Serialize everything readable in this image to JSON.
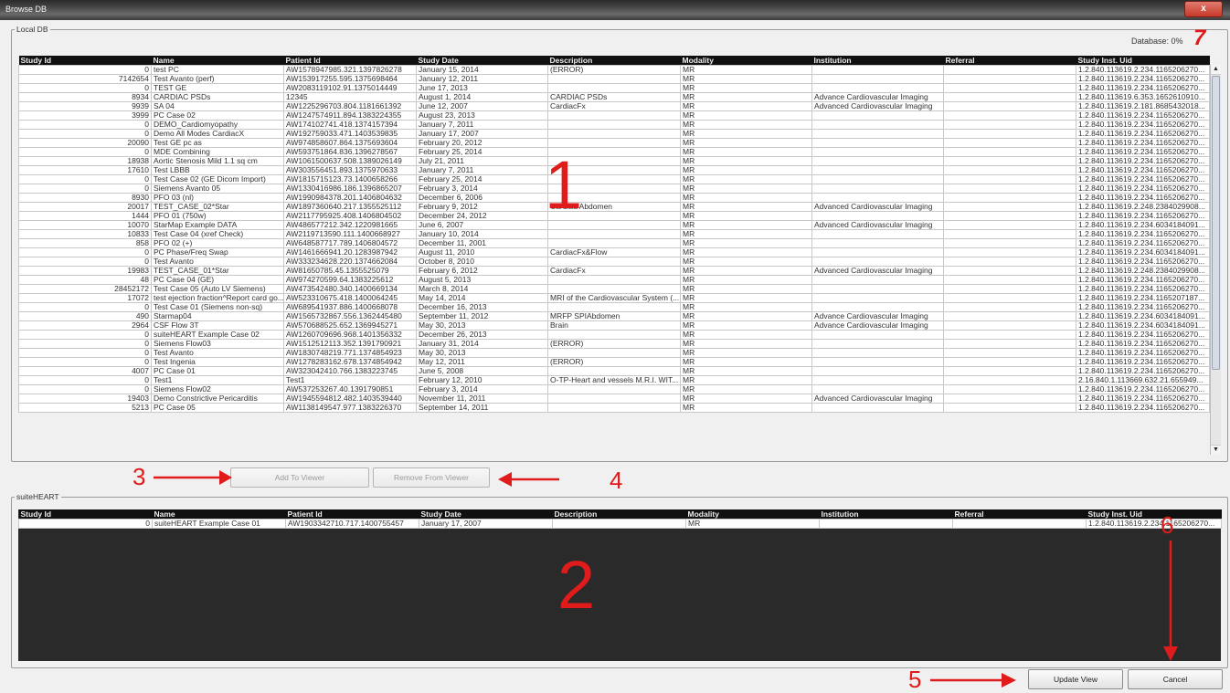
{
  "window": {
    "title": "Browse DB",
    "close_label": "x"
  },
  "local_db": {
    "label": "Local DB",
    "status": "Database:  0%",
    "columns": [
      "Study Id",
      "Name",
      "Patient Id",
      "Study Date",
      "Description",
      "Modality",
      "Institution",
      "Referral",
      "Study Inst. Uid"
    ],
    "rows": [
      [
        "0",
        "test PC",
        "AW1578947985.321.1397826278",
        "January 15, 2014",
        "(ERROR)",
        "MR",
        "",
        "",
        "1.2.840.113619.2.234.1165206270..."
      ],
      [
        "7142654",
        "Test Avanto (perf)",
        "AW153917255.595.1375698464",
        "January 12, 2011",
        "",
        "MR",
        "",
        "",
        "1.2.840.113619.2.234.1165206270..."
      ],
      [
        "0",
        "TEST GE",
        "AW2083119102.91.1375014449",
        "June 17, 2013",
        "",
        "MR",
        "",
        "",
        "1.2.840.113619.2.234.1165206270..."
      ],
      [
        "8934",
        "CARDIAC PSDs",
        "12345",
        "August 1, 2014",
        "CARDIAC PSDs",
        "MR",
        "Advance Cardiovascular Imaging",
        "",
        "1.2.840.113619.6.353.1652610910..."
      ],
      [
        "9939",
        "SA 04",
        "AW1225296703.804.1181661392",
        "June 12, 2007",
        "CardiacFx",
        "MR",
        "Advanced Cardiovascular Imaging",
        "",
        "1.2.840.113619.2.181.8685432018..."
      ],
      [
        "3999",
        "PC Case 02",
        "AW1247574911.894.1383224355",
        "August 23, 2013",
        "",
        "MR",
        "",
        "",
        "1.2.840.113619.2.234.1165206270..."
      ],
      [
        "0",
        "DEMO_Cardiomyopathy",
        "AW174102741.418.1374157394",
        "January 7, 2011",
        "",
        "MR",
        "",
        "",
        "1.2.840.113619.2.234.1165206270..."
      ],
      [
        "0",
        "Demo All Modes CardiacX",
        "AW192759033.471.1403539835",
        "January 17, 2007",
        "",
        "MR",
        "",
        "",
        "1.2.840.113619.2.234.1165206270..."
      ],
      [
        "20090",
        "Test GE pc as",
        "AW974858607.864.1375693604",
        "February 20, 2012",
        "",
        "MR",
        "",
        "",
        "1.2.840.113619.2.234.1165206270..."
      ],
      [
        "0",
        "MDE Combining",
        "AW593751864.836.1396278567",
        "February 25, 2014",
        "",
        "MR",
        "",
        "",
        "1.2.840.113619.2.234.1165206270..."
      ],
      [
        "18938",
        "Aortic Stenosis Mild 1.1 sq cm",
        "AW1061500637.508.1389026149",
        "July 21, 2011",
        "",
        "MR",
        "",
        "",
        "1.2.840.113619.2.234.1165206270..."
      ],
      [
        "17610",
        "Test LBBB",
        "AW303556451.893.1375970633",
        "January 7, 2011",
        "",
        "MR",
        "",
        "",
        "1.2.840.113619.2.234.1165206270..."
      ],
      [
        "0",
        "Test Case 02 (GE Dicom Import)",
        "AW1815715123.73.1400658266",
        "February 25, 2014",
        "",
        "MR",
        "",
        "",
        "1.2.840.113619.2.234.1165206270..."
      ],
      [
        "0",
        "Siemens Avanto 05",
        "AW1330416986.186.1396865207",
        "February 3, 2014",
        "",
        "MR",
        "",
        "",
        "1.2.840.113619.2.234.1165206270..."
      ],
      [
        "8930",
        "PFO 03 (nl)",
        "AW1990984378.201.1406804632",
        "December 6, 2006",
        "",
        "MR",
        "",
        "",
        "1.2.840.113619.2.234.1165206270..."
      ],
      [
        "20017",
        "TEST_CASE_02*Star",
        "AW1897360640.217.1355525112",
        "February 9, 2012",
        "Cardiac/Abdomen",
        "MR",
        "Advanced Cardiovascular Imaging",
        "",
        "1.2.840.113619.2.248.2384029908..."
      ],
      [
        "1444",
        "PFO 01 (750w)",
        "AW2117795925.408.1406804502",
        "December 24, 2012",
        "",
        "MR",
        "",
        "",
        "1.2.840.113619.2.234.1165206270..."
      ],
      [
        "10070",
        "StarMap Example DATA",
        "AW486577212.342.1220981665",
        "June 6, 2007",
        "",
        "MR",
        "Advanced Cardiovascular Imaging",
        "",
        "1.2.840.113619.2.234.6034184091..."
      ],
      [
        "10833",
        "Test Case 04 (xref Check)",
        "AW2119713590.111.1400668927",
        "January 10, 2014",
        "",
        "MR",
        "",
        "",
        "1.2.840.113619.2.234.1165206270..."
      ],
      [
        "858",
        "PFO 02 (+)",
        "AW648587717.789.1406804572",
        "December 11, 2001",
        "",
        "MR",
        "",
        "",
        "1.2.840.113619.2.234.1165206270..."
      ],
      [
        "0",
        "PC Phase/Freq Swap",
        "AW1461666941.20.1283987942",
        "August 11, 2010",
        "CardiacFx&Flow",
        "MR",
        "",
        "",
        "1.2.840.113619.2.234.6034184091..."
      ],
      [
        "0",
        "Test Avanto",
        "AW333234628.220.1374662084",
        "October 8, 2010",
        "",
        "MR",
        "",
        "",
        "1.2.840.113619.2.234.1165206270..."
      ],
      [
        "19983",
        "TEST_CASE_01*Star",
        "AW81650785.45.1355525079",
        "February 6, 2012",
        "CardiacFx",
        "MR",
        "Advanced Cardiovascular Imaging",
        "",
        "1.2.840.113619.2.248.2384029908..."
      ],
      [
        "48",
        "PC Case 04 (GE)",
        "AW974270599.64.1383225612",
        "August 5, 2013",
        "",
        "MR",
        "",
        "",
        "1.2.840.113619.2.234.1165206270..."
      ],
      [
        "28452172",
        "Test Case 05 (Auto LV Siemens)",
        "AW473542480.340.1400669134",
        "March 8, 2014",
        "",
        "MR",
        "",
        "",
        "1.2.840.113619.2.234.1165206270..."
      ],
      [
        "17072",
        "test ejection fraction^Report card go...",
        "AW523310675.418.1400064245",
        "May 14, 2014",
        "MRI of the Cardiovascular System (...",
        "MR",
        "",
        "",
        "1.2.840.113619.2.234.1165207187..."
      ],
      [
        "0",
        "Test Case 01 (Siemens non-sq)",
        "AW689541937.886.1400668078",
        "December 16, 2013",
        "",
        "MR",
        "",
        "",
        "1.2.840.113619.2.234.1165206270..."
      ],
      [
        "490",
        "Starmap04",
        "AW1565732867.556.1362445480",
        "September 11, 2012",
        "MRFP SPIAbdomen",
        "MR",
        "Advance Cardiovascular Imaging",
        "",
        "1.2.840.113619.2.234.6034184091..."
      ],
      [
        "2964",
        "CSF Flow 3T",
        "AW570688525.652.1369945271",
        "May 30, 2013",
        "Brain",
        "MR",
        "Advance Cardiovascular Imaging",
        "",
        "1.2.840.113619.2.234.6034184091..."
      ],
      [
        "0",
        "suiteHEART Example Case 02",
        "AW1260709696.968.1401356332",
        "December 26, 2013",
        "",
        "MR",
        "",
        "",
        "1.2.840.113619.2.234.1165206270..."
      ],
      [
        "0",
        "Siemens Flow03",
        "AW1512512113.352.1391790921",
        "January 31, 2014",
        "(ERROR)",
        "MR",
        "",
        "",
        "1.2.840.113619.2.234.1165206270..."
      ],
      [
        "0",
        "Test Avanto",
        "AW1830748219.771.1374854923",
        "May 30, 2013",
        "",
        "MR",
        "",
        "",
        "1.2.840.113619.2.234.1165206270..."
      ],
      [
        "0",
        "Test Ingenia",
        "AW1278283162.678.1374854942",
        "May 12, 2011",
        "(ERROR)",
        "MR",
        "",
        "",
        "1.2.840.113619.2.234.1165206270..."
      ],
      [
        "4007",
        "PC Case 01",
        "AW323042410.766.1383223745",
        "June 5, 2008",
        "",
        "MR",
        "",
        "",
        "1.2.840.113619.2.234.1165206270..."
      ],
      [
        "0",
        "Test1",
        "Test1",
        "February 12, 2010",
        "O-TP-Heart and vessels M.R.I. WIT...",
        "MR",
        "",
        "",
        "2.16.840.1.113669.632.21.655949..."
      ],
      [
        "0",
        "Siemens Flow02",
        "AW537253267.40.1391790851",
        "February 3, 2014",
        "",
        "MR",
        "",
        "",
        "1.2.840.113619.2.234.1165206270..."
      ],
      [
        "19403",
        "Demo Constrictive Pericarditis",
        "AW1945594812.482.1403539440",
        "November 11, 2011",
        "",
        "MR",
        "Advanced Cardiovascular Imaging",
        "",
        "1.2.840.113619.2.234.1165206270..."
      ],
      [
        "5213",
        "PC Case 05",
        "AW1138149547.977.1383226370",
        "September 14, 2011",
        "",
        "MR",
        "",
        "",
        "1.2.840.113619.2.234.1165206270..."
      ]
    ]
  },
  "buttons": {
    "add_to_viewer": "Add To Viewer",
    "remove_from_viewer": "Remove From Viewer",
    "update_view": "Update View",
    "cancel": "Cancel"
  },
  "suiteheart": {
    "label": "suiteHEART",
    "columns": [
      "Study Id",
      "Name",
      "Patient Id",
      "Study Date",
      "Description",
      "Modality",
      "Institution",
      "Referral",
      "Study Inst. Uid"
    ],
    "rows": [
      [
        "0",
        "suiteHEART Example Case 01",
        "AW1903342710.717.1400755457",
        "January 17, 2007",
        "",
        "MR",
        "",
        "",
        "1.2.840.113619.2.234.1165206270..."
      ]
    ]
  },
  "callouts": {
    "c1": "1",
    "c2": "2",
    "c3": "3",
    "c4": "4",
    "c5": "5",
    "c6": "6",
    "c7": "7"
  },
  "colors": {
    "callout": "#e01b1b",
    "header_bg": "#101010",
    "empty_area": "#2a2a2a"
  }
}
